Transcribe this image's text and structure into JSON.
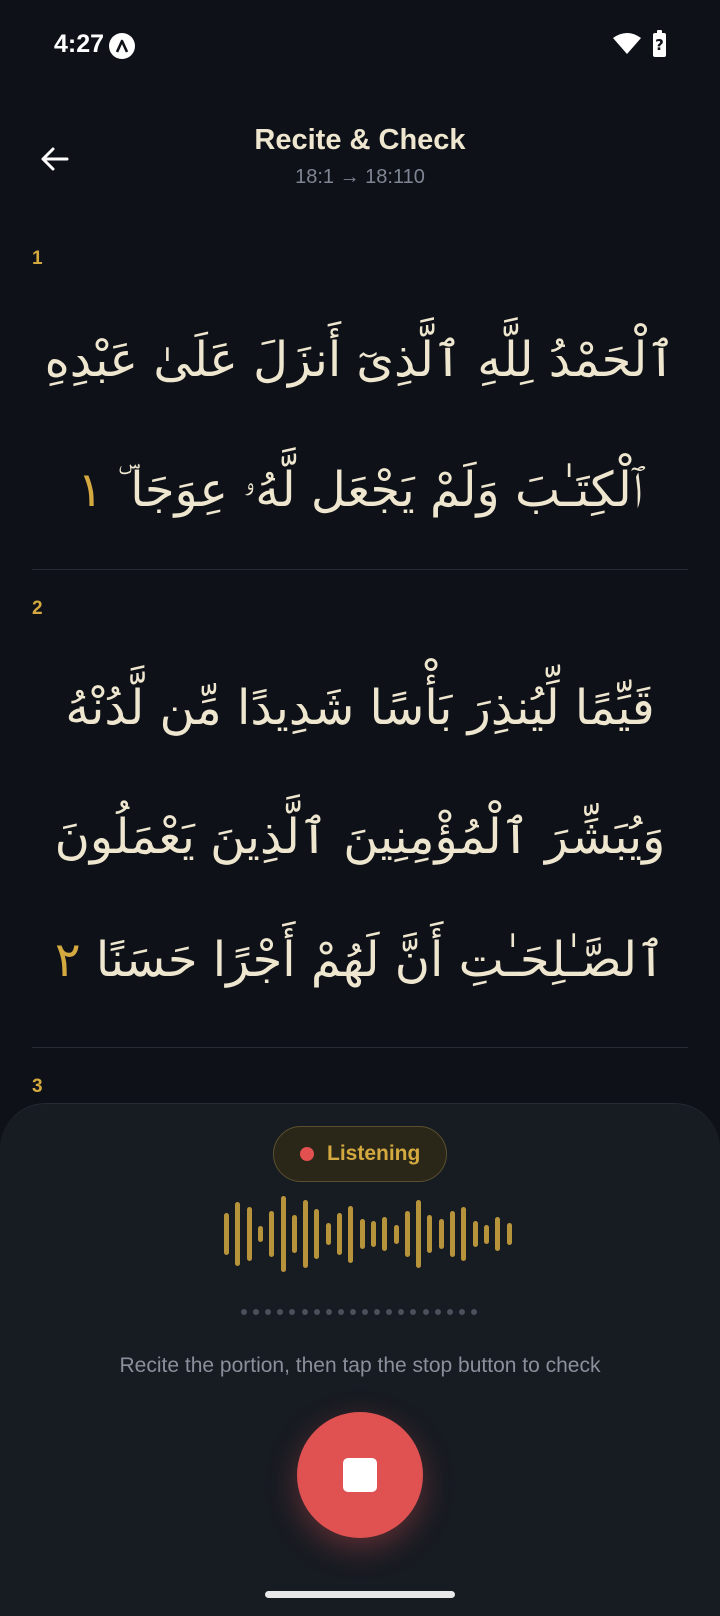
{
  "status_bar": {
    "time": "4:27",
    "icons": [
      "notification-a-icon",
      "wifi-icon",
      "battery-icon"
    ],
    "battery_glyph": "?"
  },
  "header": {
    "title": "Recite & Check",
    "subtitle": "18:1 → 18:110",
    "back_icon": "arrow-left-icon"
  },
  "verses": [
    {
      "number": "1",
      "lines": [
        "ٱلْحَمْدُ لِلَّهِ ٱلَّذِىٓ أَنزَلَ عَلَىٰ عَبْدِهِ",
        "ٱلْكِتَـٰبَ وَلَمْ يَجْعَل لَّهُۥ عِوَجَا ۜ"
      ],
      "ayah_marker": "١"
    },
    {
      "number": "2",
      "lines": [
        "قَيِّمًا لِّيُنذِرَ بَأْسًا شَدِيدًا مِّن لَّدُنْهُ",
        "وَيُبَشِّرَ ٱلْمُؤْمِنِينَ ٱلَّذِينَ يَعْمَلُونَ",
        "ٱلصَّـٰلِحَـٰتِ أَنَّ لَهُمْ أَجْرًا حَسَنًا"
      ],
      "ayah_marker": "٢"
    },
    {
      "number": "3"
    }
  ],
  "recorder": {
    "status_label": "Listening",
    "hint": "Recite the portion, then tap the stop button to check",
    "stop_icon": "stop-icon",
    "colors": {
      "accent": "#d4a93f",
      "record": "#e05252"
    },
    "waveform_levels": [
      0.55,
      0.85,
      0.7,
      0.2,
      0.6,
      1.0,
      0.5,
      0.9,
      0.65,
      0.3,
      0.55,
      0.75,
      0.4,
      0.35,
      0.45,
      0.25,
      0.6,
      0.9,
      0.5,
      0.4,
      0.6,
      0.7,
      0.35,
      0.25,
      0.45,
      0.3
    ],
    "progress_dots": 20
  }
}
